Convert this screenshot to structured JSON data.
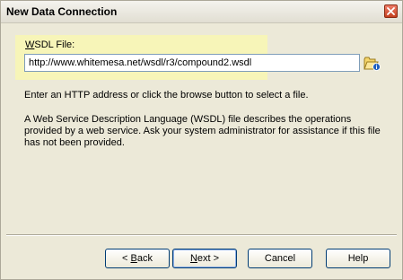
{
  "window": {
    "title": "New Data Connection"
  },
  "wsdl": {
    "label_underline": "W",
    "label_rest": "SDL File:",
    "value": "http://www.whitemesa.net/wsdl/r3/compound2.wsdl"
  },
  "hint": "Enter an HTTP address or click the browse button to select a file.",
  "description": "A Web Service Description Language (WSDL) file describes the operations provided by a web service.  Ask your system administrator for assistance if this file has not been provided.",
  "buttons": {
    "back_prefix": "< ",
    "back_underline": "B",
    "back_rest": "ack",
    "next_underline": "N",
    "next_rest": "ext >",
    "cancel": "Cancel",
    "help": "Help"
  },
  "colors": {
    "highlight": "#f7f5b8",
    "dialog_bg": "#ece9d8",
    "close_button": "#c4401f"
  },
  "icons": {
    "close": "close-icon",
    "browse": "folder-open-icon"
  }
}
